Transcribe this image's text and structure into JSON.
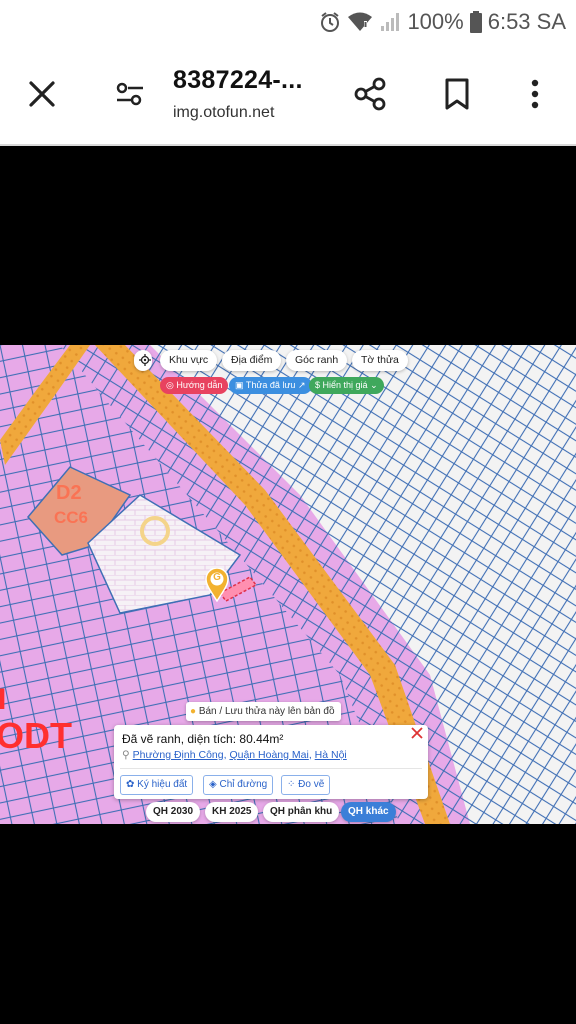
{
  "status": {
    "battery": "100%",
    "time": "6:53 SA"
  },
  "header": {
    "title": "8387224-...",
    "url": "img.otofun.net"
  },
  "map": {
    "top_chips": [
      "Khu vực",
      "Địa điểm",
      "Góc ranh",
      "Tờ thửa"
    ],
    "pills": {
      "guide": "Hướng dẫn",
      "saved": "Thửa đã lưu",
      "price": "Hiển thị giá"
    },
    "zone_label_1": "D2",
    "zone_label_2": "CC6",
    "zone_label_big": "ODT",
    "zone_label_left": "I",
    "pin_letter": "G",
    "save_banner": "Bán / Lưu thửa này lên bản đồ",
    "popup": {
      "title": "Đã vẽ ranh, diện tích: 80.44m²",
      "ward": "Phường Định Công",
      "district": "Quận Hoàng Mai",
      "city": "Hà Nội",
      "sep1": ",",
      "sep2": ",",
      "btn_legend": "Ký hiệu đất",
      "btn_directions": "Chỉ đường",
      "btn_measure": "Đo vẽ"
    },
    "plan_tabs": [
      "QH 2030",
      "KH 2025",
      "QH phân khu",
      "QH khác"
    ],
    "colors": {
      "residential": "#e7a9e8",
      "road": "#f0a83c",
      "lot_line": "#3f6fb5",
      "public": "#e89a80"
    }
  }
}
